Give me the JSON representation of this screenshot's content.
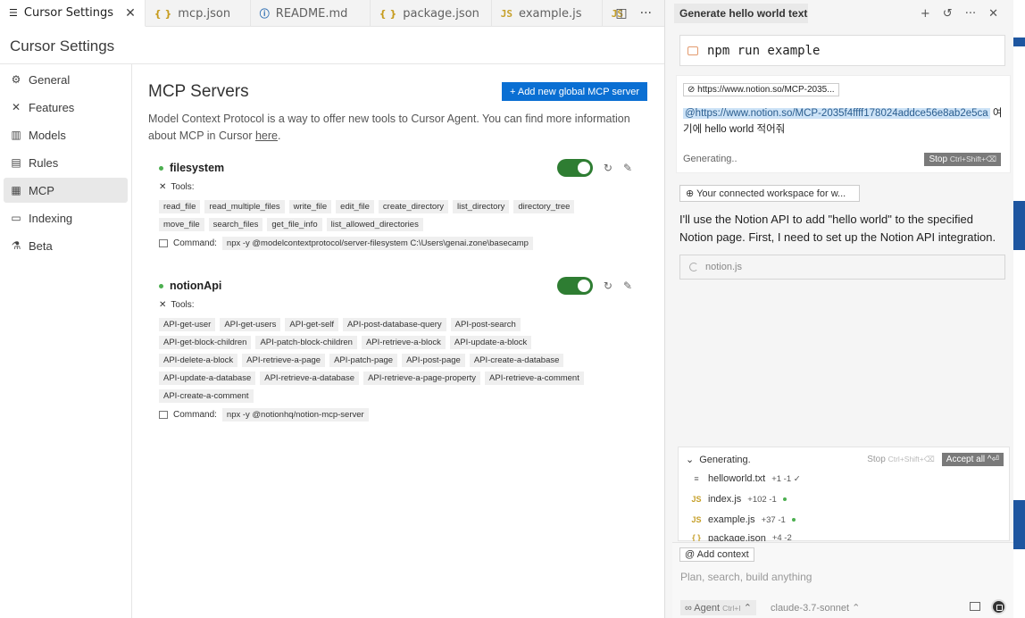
{
  "tabs": [
    {
      "icon": "settings-icon",
      "label": "Cursor Settings",
      "active": true
    },
    {
      "icon": "json-icon",
      "glyph": "{ }",
      "label": "mcp.json"
    },
    {
      "icon": "info-icon",
      "glyph": "ⓘ",
      "label": "README.md"
    },
    {
      "icon": "json-icon",
      "glyph": "{ }",
      "label": "package.json"
    },
    {
      "icon": "js-icon",
      "glyph": "JS",
      "label": "example.js"
    },
    {
      "icon": "js-icon",
      "glyph": "JS",
      "label": ""
    }
  ],
  "settings": {
    "title": "Cursor Settings",
    "nav": [
      {
        "icon": "gear-icon",
        "glyph": "⚙",
        "label": "General"
      },
      {
        "icon": "wrench-icon",
        "glyph": "✕",
        "label": "Features"
      },
      {
        "icon": "bar-chart-icon",
        "glyph": "▥",
        "label": "Models"
      },
      {
        "icon": "document-icon",
        "glyph": "▤",
        "label": "Rules"
      },
      {
        "icon": "server-icon",
        "glyph": "▦",
        "label": "MCP",
        "active": true
      },
      {
        "icon": "database-icon",
        "glyph": "▭",
        "label": "Indexing"
      },
      {
        "icon": "flask-icon",
        "glyph": "⚗",
        "label": "Beta"
      }
    ]
  },
  "mcp": {
    "title": "MCP Servers",
    "add_button": "+ Add new global MCP server",
    "description": "Model Context Protocol is a way to offer new tools to Cursor Agent. You can find more information about MCP in Cursor ",
    "link": "here",
    "link_suffix": ".",
    "tools_label": "Tools:",
    "command_label": "Command:",
    "servers": [
      {
        "name": "filesystem",
        "enabled": true,
        "tools": [
          "read_file",
          "read_multiple_files",
          "write_file",
          "edit_file",
          "create_directory",
          "list_directory",
          "directory_tree",
          "move_file",
          "search_files",
          "get_file_info",
          "list_allowed_directories"
        ],
        "command": "npx -y @modelcontextprotocol/server-filesystem C:\\Users\\genai.zone\\basecamp"
      },
      {
        "name": "notionApi",
        "enabled": true,
        "tools": [
          "API-get-user",
          "API-get-users",
          "API-get-self",
          "API-post-database-query",
          "API-post-search",
          "API-get-block-children",
          "API-patch-block-children",
          "API-retrieve-a-block",
          "API-update-a-block",
          "API-delete-a-block",
          "API-retrieve-a-page",
          "API-patch-page",
          "API-post-page",
          "API-create-a-database",
          "API-update-a-database",
          "API-retrieve-a-database",
          "API-retrieve-a-page-property",
          "API-retrieve-a-comment",
          "API-create-a-comment"
        ],
        "command": "npx -y @notionhq/notion-mcp-server"
      }
    ]
  },
  "chat": {
    "tab_title": "Generate hello world text",
    "prompt_text": "npm run example",
    "url_chip": "https://www.notion.so/MCP-2035...",
    "mention": "@https://www.notion.so/MCP-2035f4ffff178024addce56e8ab2e5ca",
    "mention_suffix": " 여기에 hello world 적어줘",
    "generating": "Generating..",
    "stop_label": "Stop",
    "stop_shortcut": "Ctrl+Shift+⌫",
    "workspace_chip": "Your connected workspace for w...",
    "assistant_text": "I'll use the Notion API to add \"hello world\" to the specified Notion page. First, I need to set up the Notion API integration.",
    "file_pill": "notion.js",
    "gen_panel": {
      "status": "Generating.",
      "stop_label": "Stop",
      "stop_shortcut": "Ctrl+Shift+⌫",
      "accept_all": "Accept all ^⏎",
      "files": [
        {
          "icon": "text-file-icon",
          "glyph": "≡",
          "name": "helloworld.txt",
          "diff": "+1 -1 ✓"
        },
        {
          "icon": "js-icon",
          "glyph": "JS",
          "name": "index.js",
          "diff": "+102 -1"
        },
        {
          "icon": "js-icon",
          "glyph": "JS",
          "name": "example.js",
          "diff": "+37 -1"
        },
        {
          "icon": "json-icon",
          "glyph": "{ }",
          "name": "package.json",
          "diff": "+4 -2"
        }
      ]
    },
    "composer": {
      "add_context": "@ Add context",
      "placeholder": "Plan, search, build anything",
      "agent_label": "∞ Agent",
      "agent_shortcut": "Ctrl+I",
      "model": "claude-3.7-sonnet"
    }
  },
  "colors": {
    "accent": "#0a6fd3",
    "toggle_on": "#2e7d32",
    "status_dot": "#4caf50",
    "mention_bg": "#cde3f7"
  }
}
